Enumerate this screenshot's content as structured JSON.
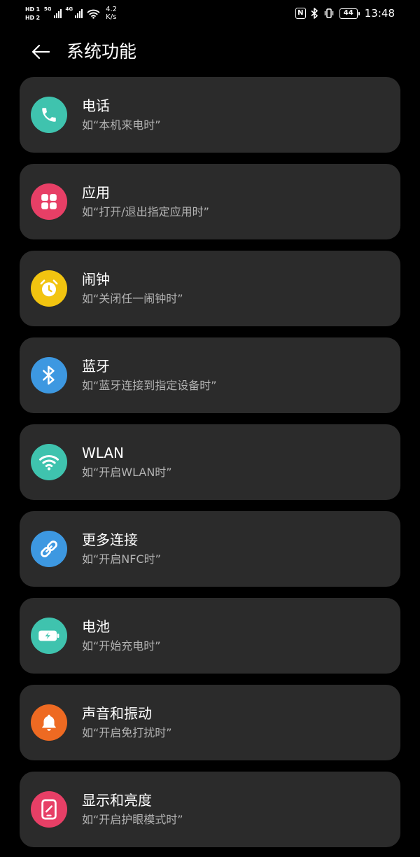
{
  "status_bar": {
    "hd1": "HD 1",
    "hd2": "HD 2",
    "net1": "5G",
    "net2": "4G",
    "speed_value": "4.2",
    "speed_unit": "K/s",
    "nfc": "N",
    "battery": "44",
    "time": "13:48"
  },
  "header": {
    "title": "系统功能"
  },
  "items": [
    {
      "title": "电话",
      "subtitle": "如“本机来电时”",
      "color": "#3fc3ae",
      "icon": "phone-icon"
    },
    {
      "title": "应用",
      "subtitle": "如“打开/退出指定应用时”",
      "color": "#e73f66",
      "icon": "apps-grid-icon"
    },
    {
      "title": "闹钟",
      "subtitle": "如“关闭任一闹钟时”",
      "color": "#f2c410",
      "icon": "alarm-clock-icon"
    },
    {
      "title": "蓝牙",
      "subtitle": "如“蓝牙连接到指定设备时”",
      "color": "#3d98e1",
      "icon": "bluetooth-icon"
    },
    {
      "title": "WLAN",
      "subtitle": "如“开启WLAN时”",
      "color": "#3fc3ae",
      "icon": "wifi-icon"
    },
    {
      "title": "更多连接",
      "subtitle": "如“开启NFC时”",
      "color": "#3d98e1",
      "icon": "link-icon"
    },
    {
      "title": "电池",
      "subtitle": "如“开始充电时”",
      "color": "#3fc3ae",
      "icon": "battery-charging-icon"
    },
    {
      "title": "声音和振动",
      "subtitle": "如“开启免打扰时”",
      "color": "#ee6a22",
      "icon": "bell-icon"
    },
    {
      "title": "显示和亮度",
      "subtitle": "如“开启护眼模式时”",
      "color": "#e73f66",
      "icon": "display-phone-icon"
    }
  ]
}
